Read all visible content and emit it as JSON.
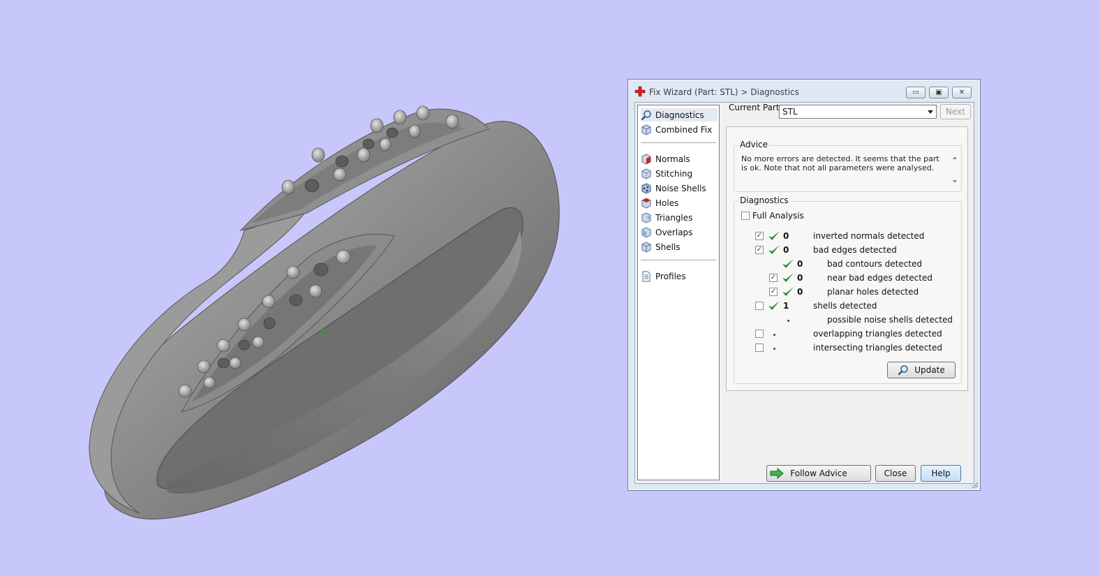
{
  "window": {
    "title": "Fix Wizard (Part: STL) > Diagnostics",
    "controls": {
      "minimize": "▭",
      "restore": "▣",
      "close": "✕"
    }
  },
  "nav": {
    "items": [
      {
        "label": "Diagnostics",
        "icon": "magnifier-icon"
      },
      {
        "label": "Combined Fix",
        "icon": "cube-icon"
      },
      {
        "label": "Normals",
        "icon": "normals-cube-icon"
      },
      {
        "label": "Stitching",
        "icon": "stitching-cube-icon"
      },
      {
        "label": "Noise Shells",
        "icon": "noise-shells-icon"
      },
      {
        "label": "Holes",
        "icon": "holes-cube-icon"
      },
      {
        "label": "Triangles",
        "icon": "triangles-cube-icon"
      },
      {
        "label": "Overlaps",
        "icon": "overlaps-cube-icon"
      },
      {
        "label": "Shells",
        "icon": "shells-cube-icon"
      },
      {
        "label": "Profiles",
        "icon": "profiles-document-icon"
      }
    ]
  },
  "current_part": {
    "label": "Current Part:",
    "value": "STL"
  },
  "next_label": "Next",
  "advice": {
    "title": "Advice",
    "text": "No more errors are detected. It seems that the part is ok. Note that not all parameters were analysed."
  },
  "diagnostics": {
    "title": "Diagnostics",
    "full_analysis_label": "Full Analysis",
    "rows": [
      {
        "value": "0",
        "label": "inverted normals detected"
      },
      {
        "value": "0",
        "label": "bad edges detected"
      },
      {
        "value": "0",
        "label": "bad contours detected"
      },
      {
        "value": "0",
        "label": "near bad edges detected"
      },
      {
        "value": "0",
        "label": "planar holes detected"
      },
      {
        "value": "1",
        "label": "shells detected"
      },
      {
        "value": "",
        "label": "possible noise shells detected"
      },
      {
        "value": "",
        "label": "overlapping triangles detected"
      },
      {
        "value": "",
        "label": "intersecting triangles detected"
      }
    ],
    "update_label": "Update"
  },
  "buttons": {
    "follow_advice": "Follow Advice",
    "close": "Close",
    "help": "Help"
  },
  "colors": {
    "background": "#c8c7fb",
    "model": "#8a8a8a",
    "check": "#1f8a2c",
    "window": "#dfe9f5"
  }
}
